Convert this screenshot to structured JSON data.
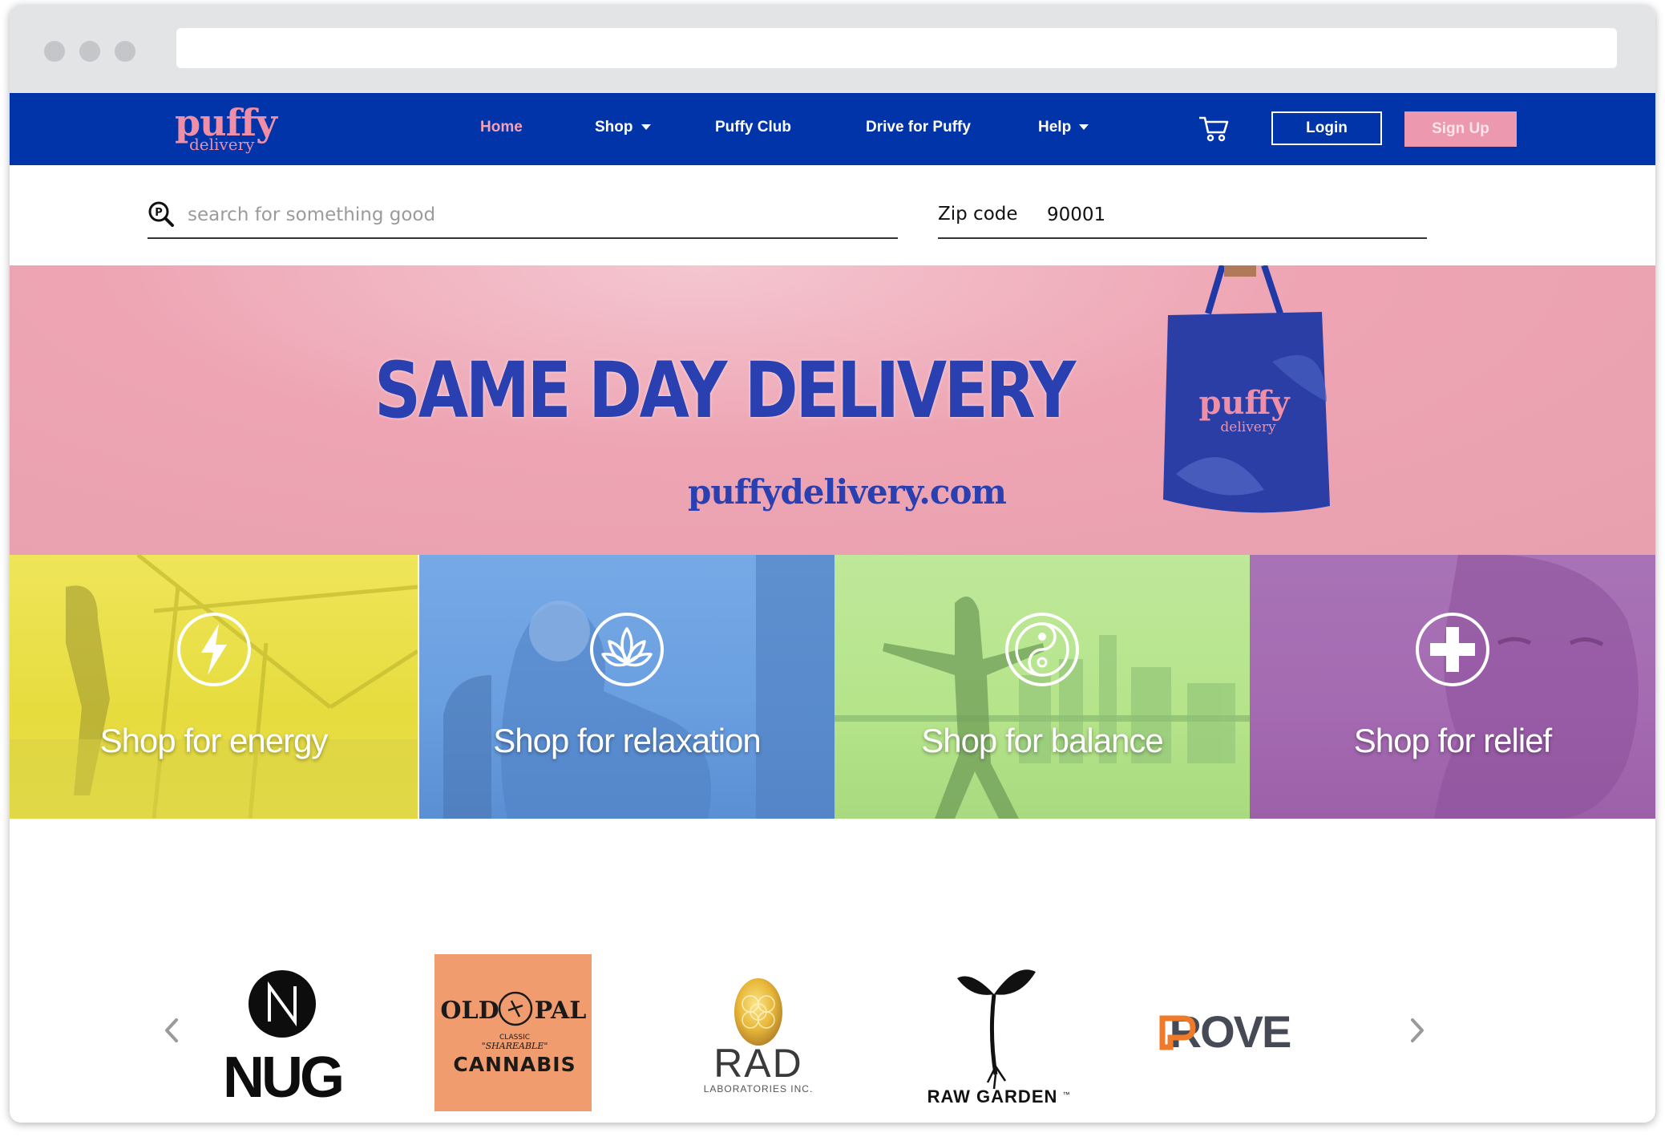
{
  "logo": {
    "top": "puffy",
    "bottom": "delivery"
  },
  "nav": {
    "items": [
      {
        "label": "Home"
      },
      {
        "label": "Shop"
      },
      {
        "label": "Puffy Club"
      },
      {
        "label": "Drive for Puffy"
      },
      {
        "label": "Help"
      }
    ],
    "cart_icon": "cart-icon",
    "login_label": "Login",
    "signup_label": "Sign Up"
  },
  "search": {
    "placeholder": "search for something good",
    "value": ""
  },
  "zip": {
    "label": "Zip code",
    "value": "90001"
  },
  "hero": {
    "title": "SAME DAY DELIVERY",
    "url": "puffydelivery.com",
    "bag_logo_top": "puffy",
    "bag_logo_bottom": "delivery"
  },
  "categories": [
    {
      "label": "Shop for energy",
      "icon": "lightning-icon",
      "color": "#ece34a"
    },
    {
      "label": "Shop for relaxation",
      "icon": "lotus-icon",
      "color": "#6fa5e4"
    },
    {
      "label": "Shop for balance",
      "icon": "yin-yang-icon",
      "color": "#b8e58f"
    },
    {
      "label": "Shop for relief",
      "icon": "plus-icon",
      "color": "#a76cb3"
    }
  ],
  "brands": [
    {
      "name": "NUG"
    },
    {
      "name_line1": "OLD",
      "name_line2": "PAL",
      "sub": "CLASSIC",
      "sub2": "\"SHAREABLE\"",
      "name_line3": "CANNABIS"
    },
    {
      "name": "RAD",
      "sub": "LABORATORIES INC."
    },
    {
      "name": "RAW GARDEN",
      "tm": "™"
    },
    {
      "name": "ROVE"
    }
  ],
  "colors": {
    "nav": "#0234a9",
    "accent": "#ee8fa7",
    "hero_text": "#2a3fb0"
  }
}
